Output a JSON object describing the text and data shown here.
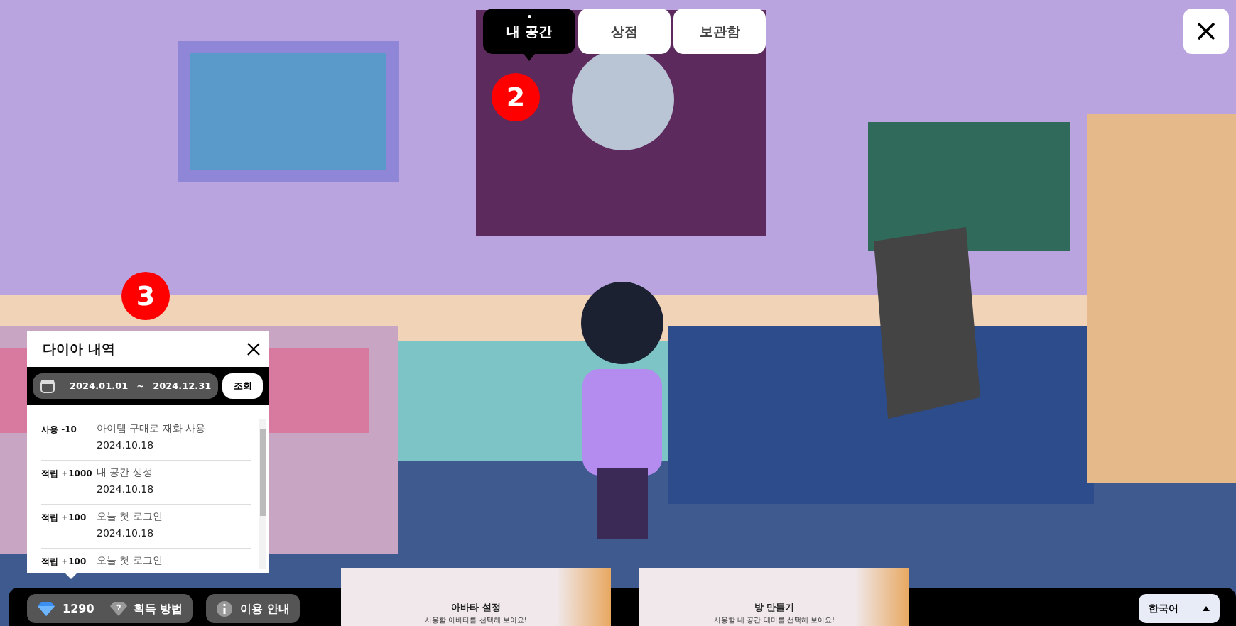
{
  "tabs": [
    {
      "label": "내 공간",
      "selected": true
    },
    {
      "label": "상점",
      "selected": false
    },
    {
      "label": "보관함",
      "selected": false
    }
  ],
  "scene": {
    "kind": "picture"
  },
  "step_markers": [
    "2",
    "3"
  ],
  "history_panel": {
    "title": "다이아 내역",
    "date_from": "2024.01.01",
    "date_separator": "~",
    "date_to": "2024.12.31",
    "search_button": "조회",
    "entries": [
      {
        "type": "사용 -10",
        "description": "아이템 구매로 재화 사용",
        "date": "2024.10.18"
      },
      {
        "type": "적립 +1000",
        "description": "내 공간 생성",
        "date": "2024.10.18"
      },
      {
        "type": "적립 +100",
        "description": "오늘 첫 로그인",
        "date": "2024.10.18"
      },
      {
        "type": "적립 +100",
        "description": "오늘 첫 로그인"
      }
    ]
  },
  "bottom_bar": {
    "diamond_count": "1290",
    "earn_button": "획득 방법",
    "guide_button": "이용 안내",
    "cards": [
      {
        "title": "아바타 설정",
        "subtitle": "사용할 아바타를 선택해 보아요!"
      },
      {
        "title": "방 만들기",
        "subtitle": "사용할 내 공간 테마를 선택해 보아요!"
      }
    ],
    "language": "한국어"
  }
}
